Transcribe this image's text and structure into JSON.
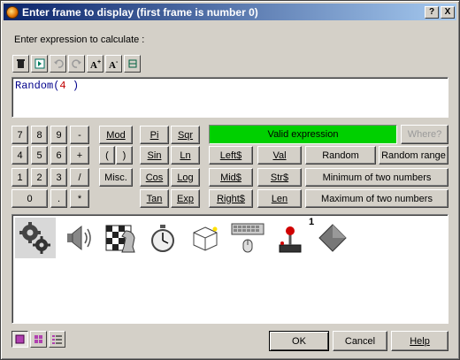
{
  "window": {
    "title": "Enter frame to display (first frame is number 0)"
  },
  "titlebar_buttons": {
    "help": "?",
    "close": "X"
  },
  "prompt_label": "Enter expression to calculate :",
  "editor": {
    "func": "Random(",
    "arg": "4",
    "close": " )"
  },
  "keypad": [
    "7",
    "8",
    "9",
    "-",
    "4",
    "5",
    "6",
    "+",
    "1",
    "2",
    "3",
    "/",
    "0",
    ".",
    "*"
  ],
  "ops": {
    "mod": "Mod",
    "paren_open": "(",
    "paren_close": ")",
    "misc": "Misc."
  },
  "math": {
    "pi": "Pi",
    "sqr": "Sqr",
    "sin": "Sin",
    "ln": "Ln",
    "cos": "Cos",
    "log": "Log",
    "tan": "Tan",
    "exp": "Exp"
  },
  "strings": {
    "left": "Left$",
    "val": "Val",
    "mid": "Mid$",
    "str": "Str$",
    "right": "Right$",
    "len": "Len"
  },
  "funcs": {
    "random": "Random",
    "random_range": "Random range",
    "min": "Minimum of two numbers",
    "max": "Maximum of two numbers"
  },
  "status": {
    "text": "Valid expression",
    "color": "#00d000"
  },
  "where_button": "Where?",
  "objects": [
    "gears-icon",
    "speaker-icon",
    "chess-icon",
    "stopwatch-icon",
    "cube-icon",
    "keyboard-mouse-icon",
    "joystick-icon",
    "diamond-icon"
  ],
  "joystick_badge": "1",
  "footer": {
    "ok": "OK",
    "cancel": "Cancel",
    "help": "Help"
  }
}
